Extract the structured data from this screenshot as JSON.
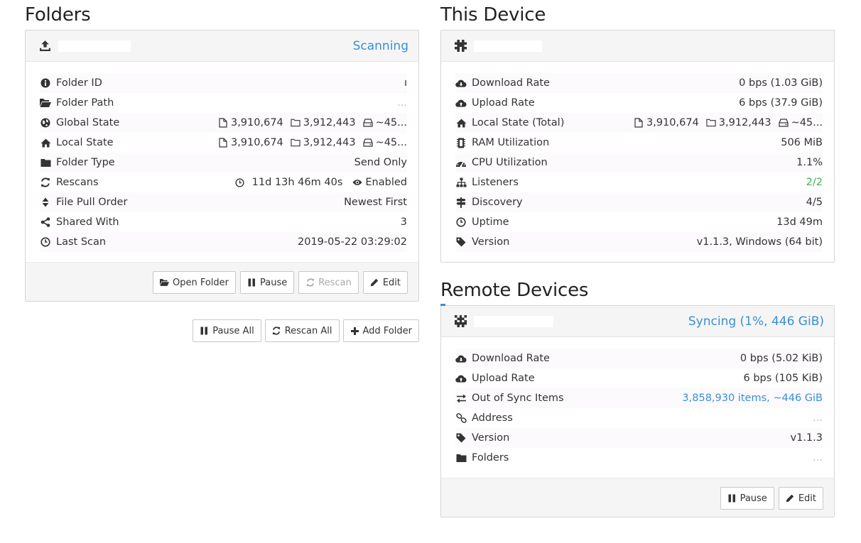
{
  "folders": {
    "heading": "Folders",
    "panel": {
      "status": "Scanning",
      "rows": [
        {
          "icon": "info-circle-icon",
          "label": "Folder ID",
          "value": "ı"
        },
        {
          "icon": "folder-open-icon",
          "label": "Folder Path",
          "value": "..."
        },
        {
          "icon": "globe-icon",
          "label": "Global State",
          "files": "3,910,674",
          "dirs": "3,912,443",
          "size": "~45..."
        },
        {
          "icon": "home-icon",
          "label": "Local State",
          "files": "3,910,674",
          "dirs": "3,912,443",
          "size": "~45..."
        },
        {
          "icon": "folder-icon",
          "label": "Folder Type",
          "value": "Send Only"
        },
        {
          "icon": "refresh-icon",
          "label": "Rescans",
          "interval": "11d 13h 46m 40s",
          "watch": "Enabled"
        },
        {
          "icon": "sort-icon",
          "label": "File Pull Order",
          "value": "Newest First"
        },
        {
          "icon": "share-icon",
          "label": "Shared With",
          "value": "3"
        },
        {
          "icon": "clock-icon",
          "label": "Last Scan",
          "value": "2019-05-22 03:29:02"
        }
      ],
      "buttons": {
        "open": "Open Folder",
        "pause": "Pause",
        "rescan": "Rescan",
        "edit": "Edit"
      }
    },
    "global_buttons": {
      "pause_all": "Pause All",
      "rescan_all": "Rescan All",
      "add_folder": "Add Folder"
    }
  },
  "this_device": {
    "heading": "This Device",
    "rows": [
      {
        "icon": "cloud-download-icon",
        "label": "Download Rate",
        "value": "0 bps (1.03 GiB)"
      },
      {
        "icon": "cloud-upload-icon",
        "label": "Upload Rate",
        "value": "6 bps (37.9 GiB)"
      },
      {
        "icon": "home-icon",
        "label": "Local State (Total)",
        "files": "3,910,674",
        "dirs": "3,912,443",
        "size": "~45..."
      },
      {
        "icon": "memory-icon",
        "label": "RAM Utilization",
        "value": "506 MiB"
      },
      {
        "icon": "dashboard-icon",
        "label": "CPU Utilization",
        "value": "1.1%"
      },
      {
        "icon": "sitemap-icon",
        "label": "Listeners",
        "value": "2/2"
      },
      {
        "icon": "signpost-icon",
        "label": "Discovery",
        "value": "4/5"
      },
      {
        "icon": "clock-icon",
        "label": "Uptime",
        "value": "13d 49m"
      },
      {
        "icon": "tag-icon",
        "label": "Version",
        "value": "v1.1.3, Windows (64 bit)"
      }
    ]
  },
  "remote_devices": {
    "heading": "Remote Devices",
    "status": "Syncing (1%, 446 GiB)",
    "rows": [
      {
        "icon": "cloud-download-icon",
        "label": "Download Rate",
        "value": "0 bps (5.02 KiB)"
      },
      {
        "icon": "cloud-upload-icon",
        "label": "Upload Rate",
        "value": "6 bps (105 KiB)"
      },
      {
        "icon": "exchange-icon",
        "label": "Out of Sync Items",
        "value": "3,858,930 items, ~446 GiB"
      },
      {
        "icon": "link-icon",
        "label": "Address",
        "value": "..."
      },
      {
        "icon": "tag-icon",
        "label": "Version",
        "value": "v1.1.3"
      },
      {
        "icon": "folder-icon",
        "label": "Folders",
        "value": "..."
      }
    ],
    "buttons": {
      "pause": "Pause",
      "edit": "Edit"
    }
  },
  "colors": {
    "accent": "#3a8fd3",
    "success": "#3db34a"
  }
}
